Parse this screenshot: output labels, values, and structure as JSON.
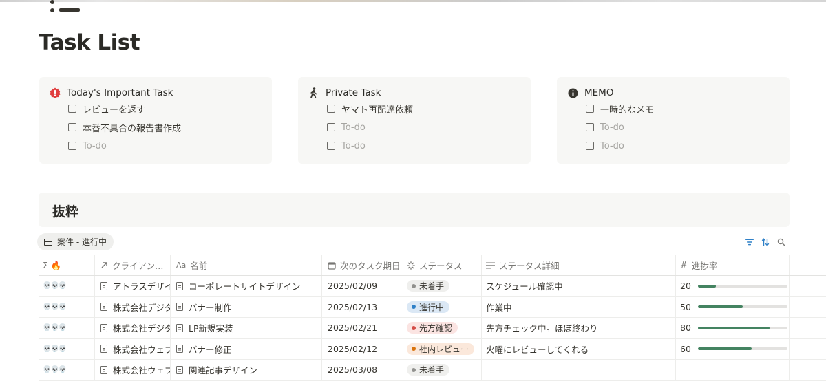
{
  "page": {
    "icon": "list-icon",
    "title": "Task List"
  },
  "callouts": [
    {
      "icon": "alert-red-icon",
      "title": "Today's Important Task",
      "todos": [
        {
          "text": "レビューを返す",
          "placeholder": false
        },
        {
          "text": "本番不具合の報告書作成",
          "placeholder": false
        },
        {
          "text": "To-do",
          "placeholder": true
        }
      ]
    },
    {
      "icon": "walking-person-icon",
      "title": "Private Task",
      "todos": [
        {
          "text": "ヤマト再配達依頼",
          "placeholder": false
        },
        {
          "text": "To-do",
          "placeholder": true
        },
        {
          "text": "To-do",
          "placeholder": true
        }
      ]
    },
    {
      "icon": "info-icon",
      "title": "MEMO",
      "todos": [
        {
          "text": "一時的なメモ",
          "placeholder": false
        },
        {
          "text": "To-do",
          "placeholder": true
        },
        {
          "text": "To-do",
          "placeholder": true
        }
      ]
    }
  ],
  "section": {
    "heading": "抜粋",
    "view_label": "案件 - 進行中"
  },
  "table": {
    "headers": {
      "c1": "Σ 🔥",
      "client": "クライアン…",
      "name": "名前",
      "due": "次のタスク期日",
      "status": "ステータス",
      "status_detail": "ステータス詳細",
      "progress": "進捗率"
    },
    "rows": [
      {
        "emoji": "💀💀💀",
        "client": "アトラスデザイン",
        "name": "コーポレートサイトデザイン",
        "due": "2025/02/09",
        "status": "未着手",
        "status_color": "#91918e",
        "status_bg": "#efefed",
        "detail": "スケジュール確認中",
        "progress": "20",
        "progress_pct": 20
      },
      {
        "emoji": "💀💀💀",
        "client": "株式会社デジタル",
        "name": "バナー制作",
        "due": "2025/02/13",
        "status": "進行中",
        "status_color": "#2f80c7",
        "status_bg": "#dbe8f5",
        "detail": "作業中",
        "progress": "50",
        "progress_pct": 50
      },
      {
        "emoji": "💀💀💀",
        "client": "株式会社デジタル",
        "name": "LP新規実装",
        "due": "2025/02/21",
        "status": "先方確認",
        "status_color": "#d44c47",
        "status_bg": "#fbe4e2",
        "detail": "先方チェック中。ほぼ終わり",
        "progress": "80",
        "progress_pct": 80
      },
      {
        "emoji": "💀💀💀",
        "client": "株式会社ウェブ",
        "name": "バナー修正",
        "due": "2025/02/12",
        "status": "社内レビュー",
        "status_color": "#d9730d",
        "status_bg": "#fbe8db",
        "detail": "火曜にレビューしてくれる",
        "progress": "60",
        "progress_pct": 60
      },
      {
        "emoji": "💀💀💀",
        "client": "株式会社ウェブ",
        "name": "関連記事デザイン",
        "due": "2025/03/08",
        "status": "未着手",
        "status_color": "#91918e",
        "status_bg": "#efefed",
        "detail": "",
        "progress": "",
        "progress_pct": null
      }
    ]
  },
  "colors": {
    "accent_blue": "#2f80c7",
    "progress_green": "#448361",
    "callout_bg": "#f7f7f5"
  }
}
